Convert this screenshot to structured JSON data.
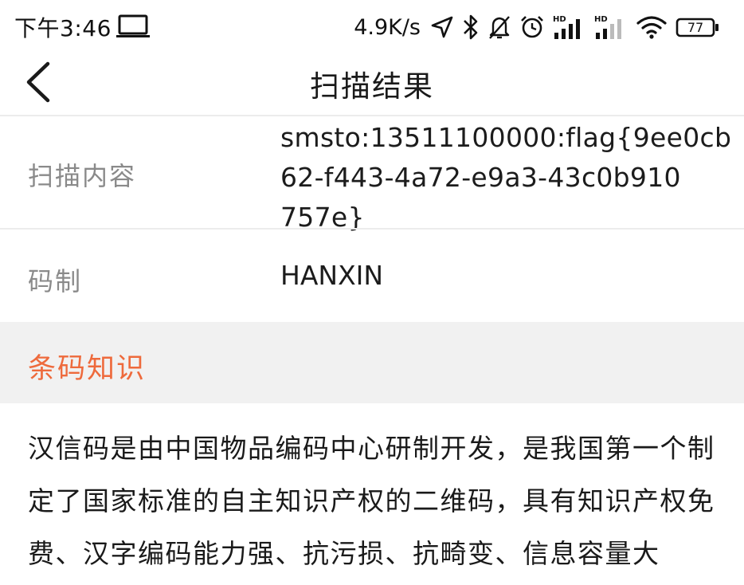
{
  "status_bar": {
    "time": "下午3:46",
    "net_speed": "4.9K/s",
    "battery_level": "77",
    "icons": [
      "laptop-icon",
      "location-arrow-icon",
      "bluetooth-icon",
      "bell-muted-icon",
      "alarm-clock-icon",
      "signal-hd-icon",
      "signal-hd-icon",
      "wifi-icon",
      "battery-icon"
    ]
  },
  "header": {
    "title": "扫描结果",
    "back_icon": "chevron-left-icon"
  },
  "result": {
    "content_label": "扫描内容",
    "content_value": "smsto:13511100000:flag{9ee0cb\n62-f443-4a72-e9a3-43c0b910\n757e}",
    "code_type_label": "码制",
    "code_type_value": "HANXIN"
  },
  "knowledge": {
    "title": "条码知识",
    "title_color": "#ee6a3c",
    "text": "汉信码是由中国物品编码中心研制开发，是我国第一个制定了国家标准的自主知识产权的二维码，具有知识产权免费、汉字编码能力强、抗污损、抗畸变、信息容量大"
  }
}
